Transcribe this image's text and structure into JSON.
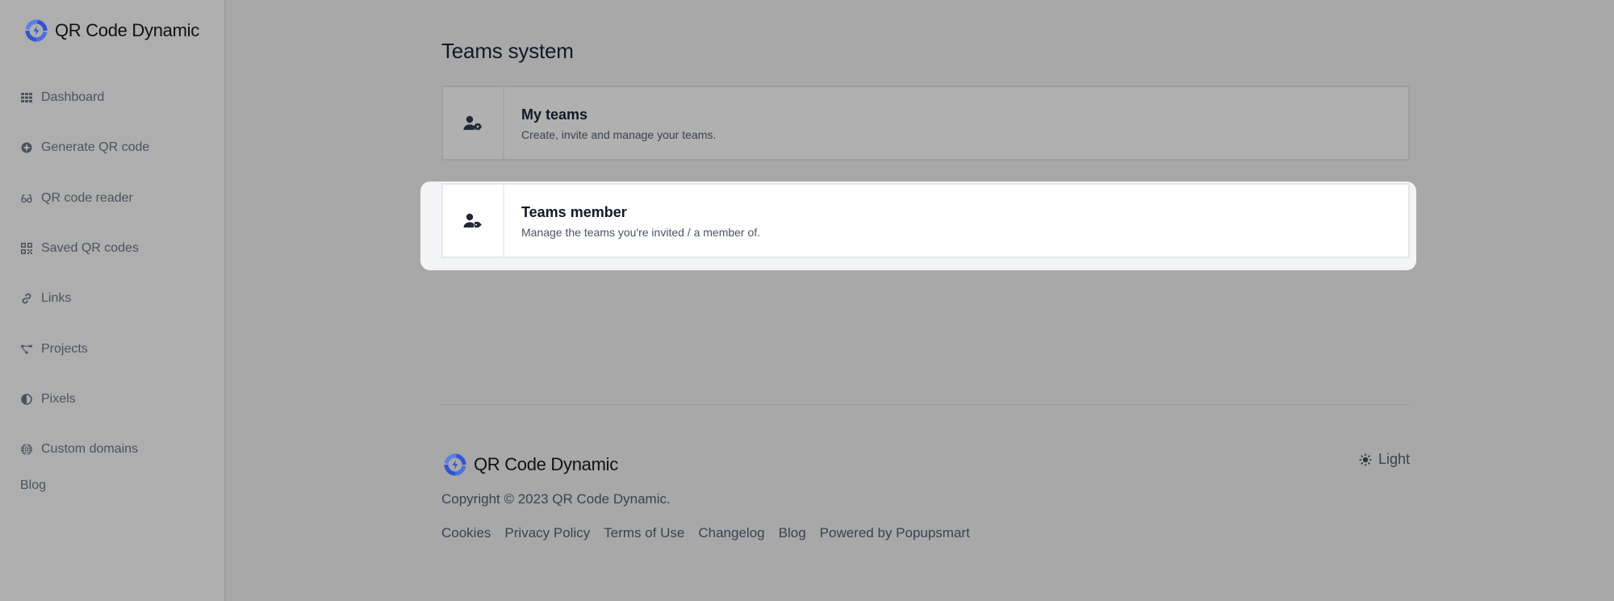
{
  "app": {
    "brand_name": "QR Code Dynamic",
    "brand_color": "#2f55d4"
  },
  "sidebar": {
    "items": [
      {
        "label": "Dashboard",
        "icon": "grid-icon"
      },
      {
        "label": "Generate QR code",
        "icon": "plus-circle-icon"
      },
      {
        "label": "QR code reader",
        "icon": "glasses-icon"
      },
      {
        "label": "Saved QR codes",
        "icon": "qrcode-icon"
      },
      {
        "label": "Links",
        "icon": "link-icon"
      },
      {
        "label": "Projects",
        "icon": "project-diagram-icon"
      },
      {
        "label": "Pixels",
        "icon": "adjust-icon"
      },
      {
        "label": "Custom domains",
        "icon": "globe-icon"
      }
    ],
    "blog_label": "Blog"
  },
  "main": {
    "title": "Teams system",
    "cards": [
      {
        "title": "My teams",
        "description": "Create, invite and manage your teams.",
        "icon": "user-cog-icon"
      },
      {
        "title": "Teams member",
        "description": "Manage the teams you're invited / a member of.",
        "icon": "user-tag-icon"
      }
    ]
  },
  "footer": {
    "brand_name": "QR Code Dynamic",
    "copyright": "Copyright © 2023 QR Code Dynamic.",
    "links": [
      "Cookies",
      "Privacy Policy",
      "Terms of Use",
      "Changelog",
      "Blog",
      "Powered by Popupsmart"
    ],
    "theme_label": "Light",
    "theme_icon": "sun-icon"
  }
}
